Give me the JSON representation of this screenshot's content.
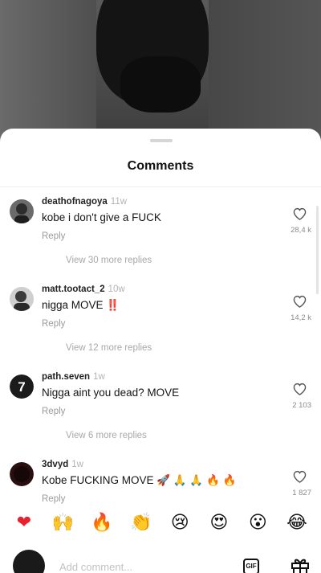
{
  "sheet": {
    "title": "Comments"
  },
  "comments": [
    {
      "username": "deathofnagoya",
      "time": "11w",
      "text": "kobe i don't give a FUCK",
      "reply_label": "Reply",
      "view_replies": "View 30 more replies",
      "like_count": "28,4 k",
      "avatar_color": "#5b5b5b"
    },
    {
      "username": "matt.tootact_2",
      "time": "10w",
      "text": "nigga MOVE ‼️",
      "reply_label": "Reply",
      "view_replies": "View 12 more replies",
      "like_count": "14,2 k",
      "avatar_color": "#3d3d3d"
    },
    {
      "username": "path.seven",
      "time": "1w",
      "text": "Nigga aint you dead? MOVE",
      "reply_label": "Reply",
      "view_replies": "View 6 more replies",
      "like_count": "2 103",
      "avatar_color": "#1b1b1b"
    },
    {
      "username": "3dvyd",
      "time": "1w",
      "text": "Kobe FUCKING MOVE 🚀 🙏 🙏 🔥 🔥",
      "reply_label": "Reply",
      "view_replies": "",
      "like_count": "1 827",
      "avatar_color": "#2a0f10"
    }
  ],
  "emoji_bar": [
    "❤",
    "🙌",
    "🔥",
    "👏",
    "😢",
    "😍",
    "😮",
    "😂"
  ],
  "composer": {
    "placeholder": "Add comment...",
    "gif_label": "GIF"
  },
  "colors": {
    "like_red": "#e8212f",
    "muted": "#9a9a9a"
  }
}
